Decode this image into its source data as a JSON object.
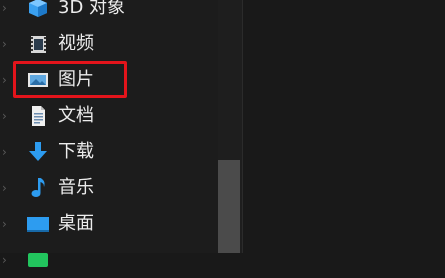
{
  "nav": {
    "items": [
      {
        "label": "3D 对象",
        "icon": "3d-objects-icon"
      },
      {
        "label": "视频",
        "icon": "videos-icon"
      },
      {
        "label": "图片",
        "icon": "pictures-icon",
        "highlighted": true
      },
      {
        "label": "文档",
        "icon": "documents-icon"
      },
      {
        "label": "下载",
        "icon": "downloads-icon"
      },
      {
        "label": "音乐",
        "icon": "music-icon"
      },
      {
        "label": "桌面",
        "icon": "desktop-icon"
      },
      {
        "label": "",
        "icon": "drive-icon"
      }
    ]
  },
  "colors": {
    "highlight": "#e3141b",
    "folder_blue": "#2d9cf0"
  }
}
